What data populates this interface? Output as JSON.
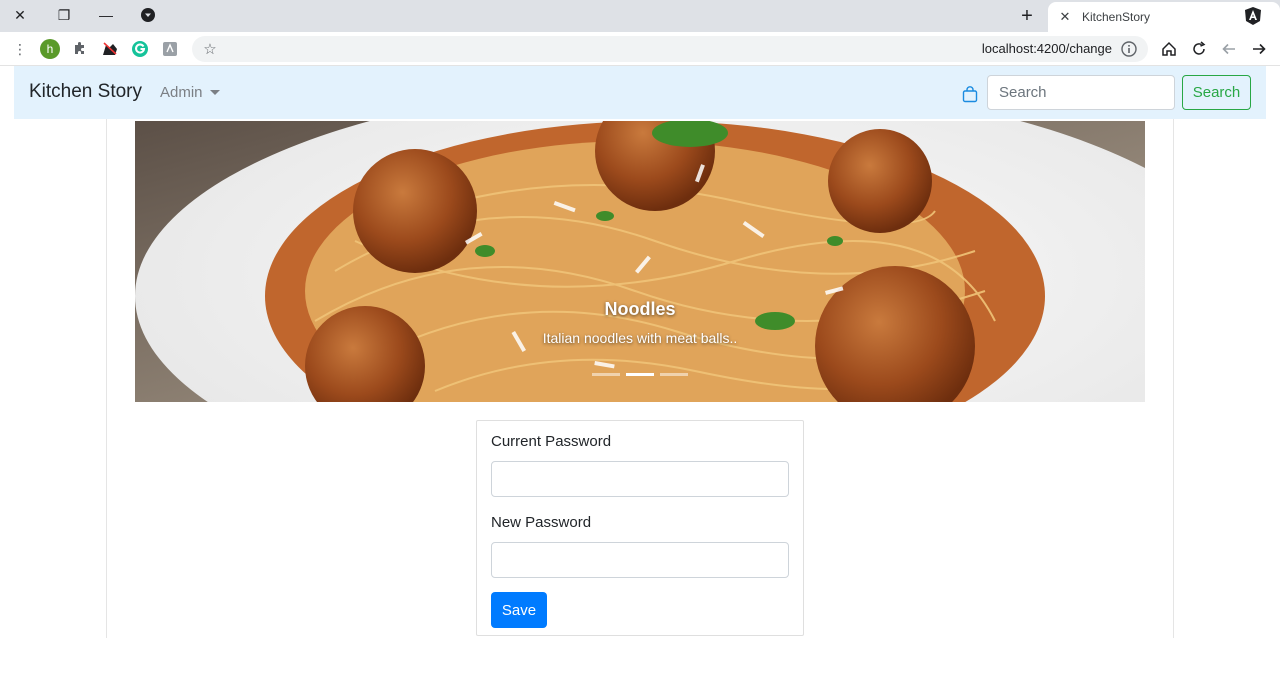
{
  "browser": {
    "tab_title": "KitchenStory",
    "url": "localhost:4200/change",
    "profile_initial": "h"
  },
  "navbar": {
    "brand": "Kitchen Story",
    "admin_label": "Admin",
    "search_placeholder": "Search",
    "search_button": "Search"
  },
  "carousel": {
    "caption_title": "Noodles",
    "caption_text": "Italian noodles with meat balls..",
    "slide_count": 3,
    "active_index": 1
  },
  "form": {
    "current_password_label": "Current Password",
    "current_password_value": "",
    "new_password_label": "New Password",
    "new_password_value": "",
    "save_button": "Save"
  },
  "colors": {
    "navbar_bg": "#e3f2fd",
    "search_green": "#28a745",
    "primary_blue": "#007bff",
    "bag_icon": "#1a8be0"
  }
}
